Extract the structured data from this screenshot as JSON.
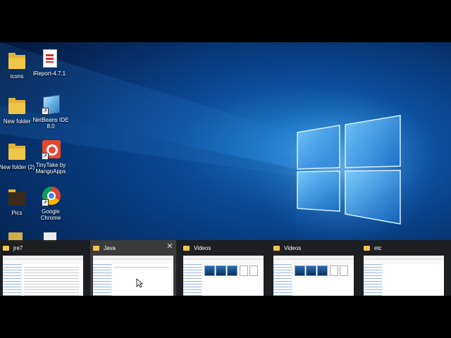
{
  "desktop": {
    "icons": [
      {
        "label": "icons",
        "icon": "folder-icon"
      },
      {
        "label": "iReport-4.7.1",
        "icon": "document-icon"
      },
      {
        "label": "New folder",
        "icon": "folder-icon"
      },
      {
        "label": "NetBeans IDE 8.0",
        "icon": "netbeans-icon"
      },
      {
        "label": "New folder (2)",
        "icon": "folder-icon"
      },
      {
        "label": "TinyTake by MangoApps",
        "icon": "tinytake-icon"
      },
      {
        "label": "Pics",
        "icon": "folder-icon"
      },
      {
        "label": "Google Chrome",
        "icon": "chrome-icon"
      }
    ]
  },
  "switcher": {
    "windows": [
      {
        "title": "jre7",
        "active": false
      },
      {
        "title": "Java",
        "active": true,
        "close": "✕"
      },
      {
        "title": "Videos",
        "active": false
      },
      {
        "title": "Videos",
        "active": false
      },
      {
        "title": "etc",
        "active": false
      }
    ]
  },
  "colors": {
    "wallpaper": "#0d4f9c",
    "folder": "#f0c64a",
    "switcher_bg": "#1e1e1e"
  }
}
